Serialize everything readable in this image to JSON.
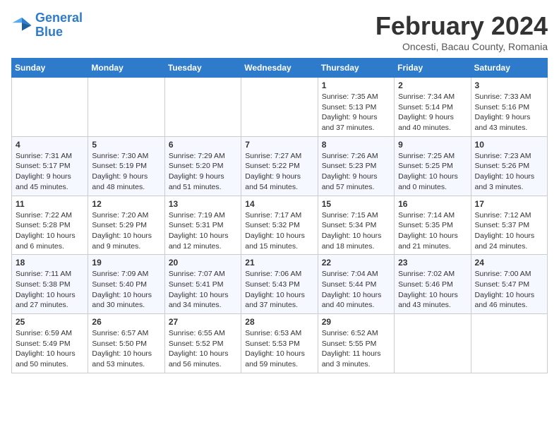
{
  "header": {
    "logo_line1": "General",
    "logo_line2": "Blue",
    "month_title": "February 2024",
    "location": "Oncesti, Bacau County, Romania"
  },
  "weekdays": [
    "Sunday",
    "Monday",
    "Tuesday",
    "Wednesday",
    "Thursday",
    "Friday",
    "Saturday"
  ],
  "weeks": [
    [
      {
        "day": "",
        "info": ""
      },
      {
        "day": "",
        "info": ""
      },
      {
        "day": "",
        "info": ""
      },
      {
        "day": "",
        "info": ""
      },
      {
        "day": "1",
        "info": "Sunrise: 7:35 AM\nSunset: 5:13 PM\nDaylight: 9 hours\nand 37 minutes."
      },
      {
        "day": "2",
        "info": "Sunrise: 7:34 AM\nSunset: 5:14 PM\nDaylight: 9 hours\nand 40 minutes."
      },
      {
        "day": "3",
        "info": "Sunrise: 7:33 AM\nSunset: 5:16 PM\nDaylight: 9 hours\nand 43 minutes."
      }
    ],
    [
      {
        "day": "4",
        "info": "Sunrise: 7:31 AM\nSunset: 5:17 PM\nDaylight: 9 hours\nand 45 minutes."
      },
      {
        "day": "5",
        "info": "Sunrise: 7:30 AM\nSunset: 5:19 PM\nDaylight: 9 hours\nand 48 minutes."
      },
      {
        "day": "6",
        "info": "Sunrise: 7:29 AM\nSunset: 5:20 PM\nDaylight: 9 hours\nand 51 minutes."
      },
      {
        "day": "7",
        "info": "Sunrise: 7:27 AM\nSunset: 5:22 PM\nDaylight: 9 hours\nand 54 minutes."
      },
      {
        "day": "8",
        "info": "Sunrise: 7:26 AM\nSunset: 5:23 PM\nDaylight: 9 hours\nand 57 minutes."
      },
      {
        "day": "9",
        "info": "Sunrise: 7:25 AM\nSunset: 5:25 PM\nDaylight: 10 hours\nand 0 minutes."
      },
      {
        "day": "10",
        "info": "Sunrise: 7:23 AM\nSunset: 5:26 PM\nDaylight: 10 hours\nand 3 minutes."
      }
    ],
    [
      {
        "day": "11",
        "info": "Sunrise: 7:22 AM\nSunset: 5:28 PM\nDaylight: 10 hours\nand 6 minutes."
      },
      {
        "day": "12",
        "info": "Sunrise: 7:20 AM\nSunset: 5:29 PM\nDaylight: 10 hours\nand 9 minutes."
      },
      {
        "day": "13",
        "info": "Sunrise: 7:19 AM\nSunset: 5:31 PM\nDaylight: 10 hours\nand 12 minutes."
      },
      {
        "day": "14",
        "info": "Sunrise: 7:17 AM\nSunset: 5:32 PM\nDaylight: 10 hours\nand 15 minutes."
      },
      {
        "day": "15",
        "info": "Sunrise: 7:15 AM\nSunset: 5:34 PM\nDaylight: 10 hours\nand 18 minutes."
      },
      {
        "day": "16",
        "info": "Sunrise: 7:14 AM\nSunset: 5:35 PM\nDaylight: 10 hours\nand 21 minutes."
      },
      {
        "day": "17",
        "info": "Sunrise: 7:12 AM\nSunset: 5:37 PM\nDaylight: 10 hours\nand 24 minutes."
      }
    ],
    [
      {
        "day": "18",
        "info": "Sunrise: 7:11 AM\nSunset: 5:38 PM\nDaylight: 10 hours\nand 27 minutes."
      },
      {
        "day": "19",
        "info": "Sunrise: 7:09 AM\nSunset: 5:40 PM\nDaylight: 10 hours\nand 30 minutes."
      },
      {
        "day": "20",
        "info": "Sunrise: 7:07 AM\nSunset: 5:41 PM\nDaylight: 10 hours\nand 34 minutes."
      },
      {
        "day": "21",
        "info": "Sunrise: 7:06 AM\nSunset: 5:43 PM\nDaylight: 10 hours\nand 37 minutes."
      },
      {
        "day": "22",
        "info": "Sunrise: 7:04 AM\nSunset: 5:44 PM\nDaylight: 10 hours\nand 40 minutes."
      },
      {
        "day": "23",
        "info": "Sunrise: 7:02 AM\nSunset: 5:46 PM\nDaylight: 10 hours\nand 43 minutes."
      },
      {
        "day": "24",
        "info": "Sunrise: 7:00 AM\nSunset: 5:47 PM\nDaylight: 10 hours\nand 46 minutes."
      }
    ],
    [
      {
        "day": "25",
        "info": "Sunrise: 6:59 AM\nSunset: 5:49 PM\nDaylight: 10 hours\nand 50 minutes."
      },
      {
        "day": "26",
        "info": "Sunrise: 6:57 AM\nSunset: 5:50 PM\nDaylight: 10 hours\nand 53 minutes."
      },
      {
        "day": "27",
        "info": "Sunrise: 6:55 AM\nSunset: 5:52 PM\nDaylight: 10 hours\nand 56 minutes."
      },
      {
        "day": "28",
        "info": "Sunrise: 6:53 AM\nSunset: 5:53 PM\nDaylight: 10 hours\nand 59 minutes."
      },
      {
        "day": "29",
        "info": "Sunrise: 6:52 AM\nSunset: 5:55 PM\nDaylight: 11 hours\nand 3 minutes."
      },
      {
        "day": "",
        "info": ""
      },
      {
        "day": "",
        "info": ""
      }
    ]
  ]
}
